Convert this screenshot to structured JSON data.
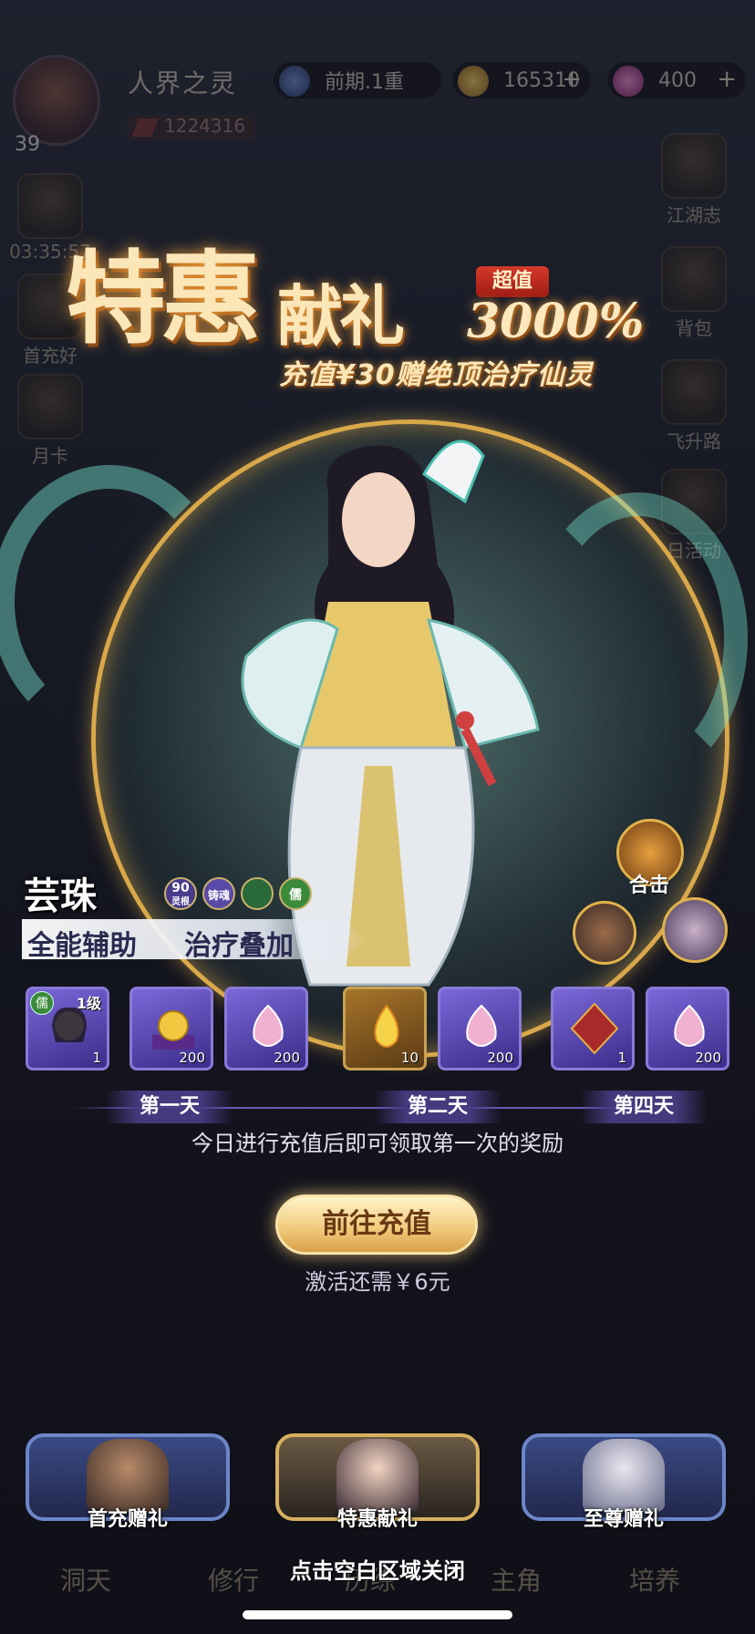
{
  "topbar": {
    "level": "39",
    "realm": "人界之灵",
    "stage": "前期.1重",
    "power": "1224316",
    "coins": "165310",
    "gems": "400",
    "plus": "+"
  },
  "side_right": [
    {
      "label": "江湖志"
    },
    {
      "label": "背包"
    },
    {
      "label": "飞升路"
    },
    {
      "label": "日活动"
    }
  ],
  "side_left": [
    {
      "label": "03:35:57"
    },
    {
      "label": "首充好"
    },
    {
      "label": "月卡"
    }
  ],
  "banner": {
    "title_big": "特惠",
    "title_mid": "献礼",
    "tag": "超值",
    "percent": "3000%",
    "subtitle": "充值¥30赠绝顶治疗仙灵"
  },
  "hero": {
    "name": "芸珠",
    "badge_root": "90",
    "badge_root_sub": "灵根",
    "badge_cast": "铸魂",
    "badge_class": "儒",
    "tag1": "全能辅助",
    "tag2": "治疗叠加",
    "combo_label": "合击"
  },
  "rewards": [
    {
      "kind": "hero",
      "count": "1",
      "level": "1级",
      "cls": "儒"
    },
    {
      "kind": "orb",
      "count": "200"
    },
    {
      "kind": "crystal",
      "count": "200"
    },
    {
      "kind": "flame",
      "count": "10"
    },
    {
      "kind": "crystal",
      "count": "200"
    },
    {
      "kind": "token",
      "count": "1"
    },
    {
      "kind": "crystal",
      "count": "200"
    }
  ],
  "days": {
    "day1": "第一天",
    "day2": "第二天",
    "day4": "第四天"
  },
  "desc": "今日进行充值后即可领取第一次的奖励",
  "cta": "前往充值",
  "need": "激活还需￥6元",
  "tabs": {
    "first": "首充赠礼",
    "special": "特惠献礼",
    "supreme": "至尊赠礼"
  },
  "close_hint": "点击空白区域关闭",
  "bottom_nav": [
    "洞天",
    "修行",
    "历练",
    "主角",
    "培养"
  ],
  "colors": {
    "gold": "#d9a84a",
    "purple_item": "#7a68d8",
    "cta": "#f0c878"
  }
}
